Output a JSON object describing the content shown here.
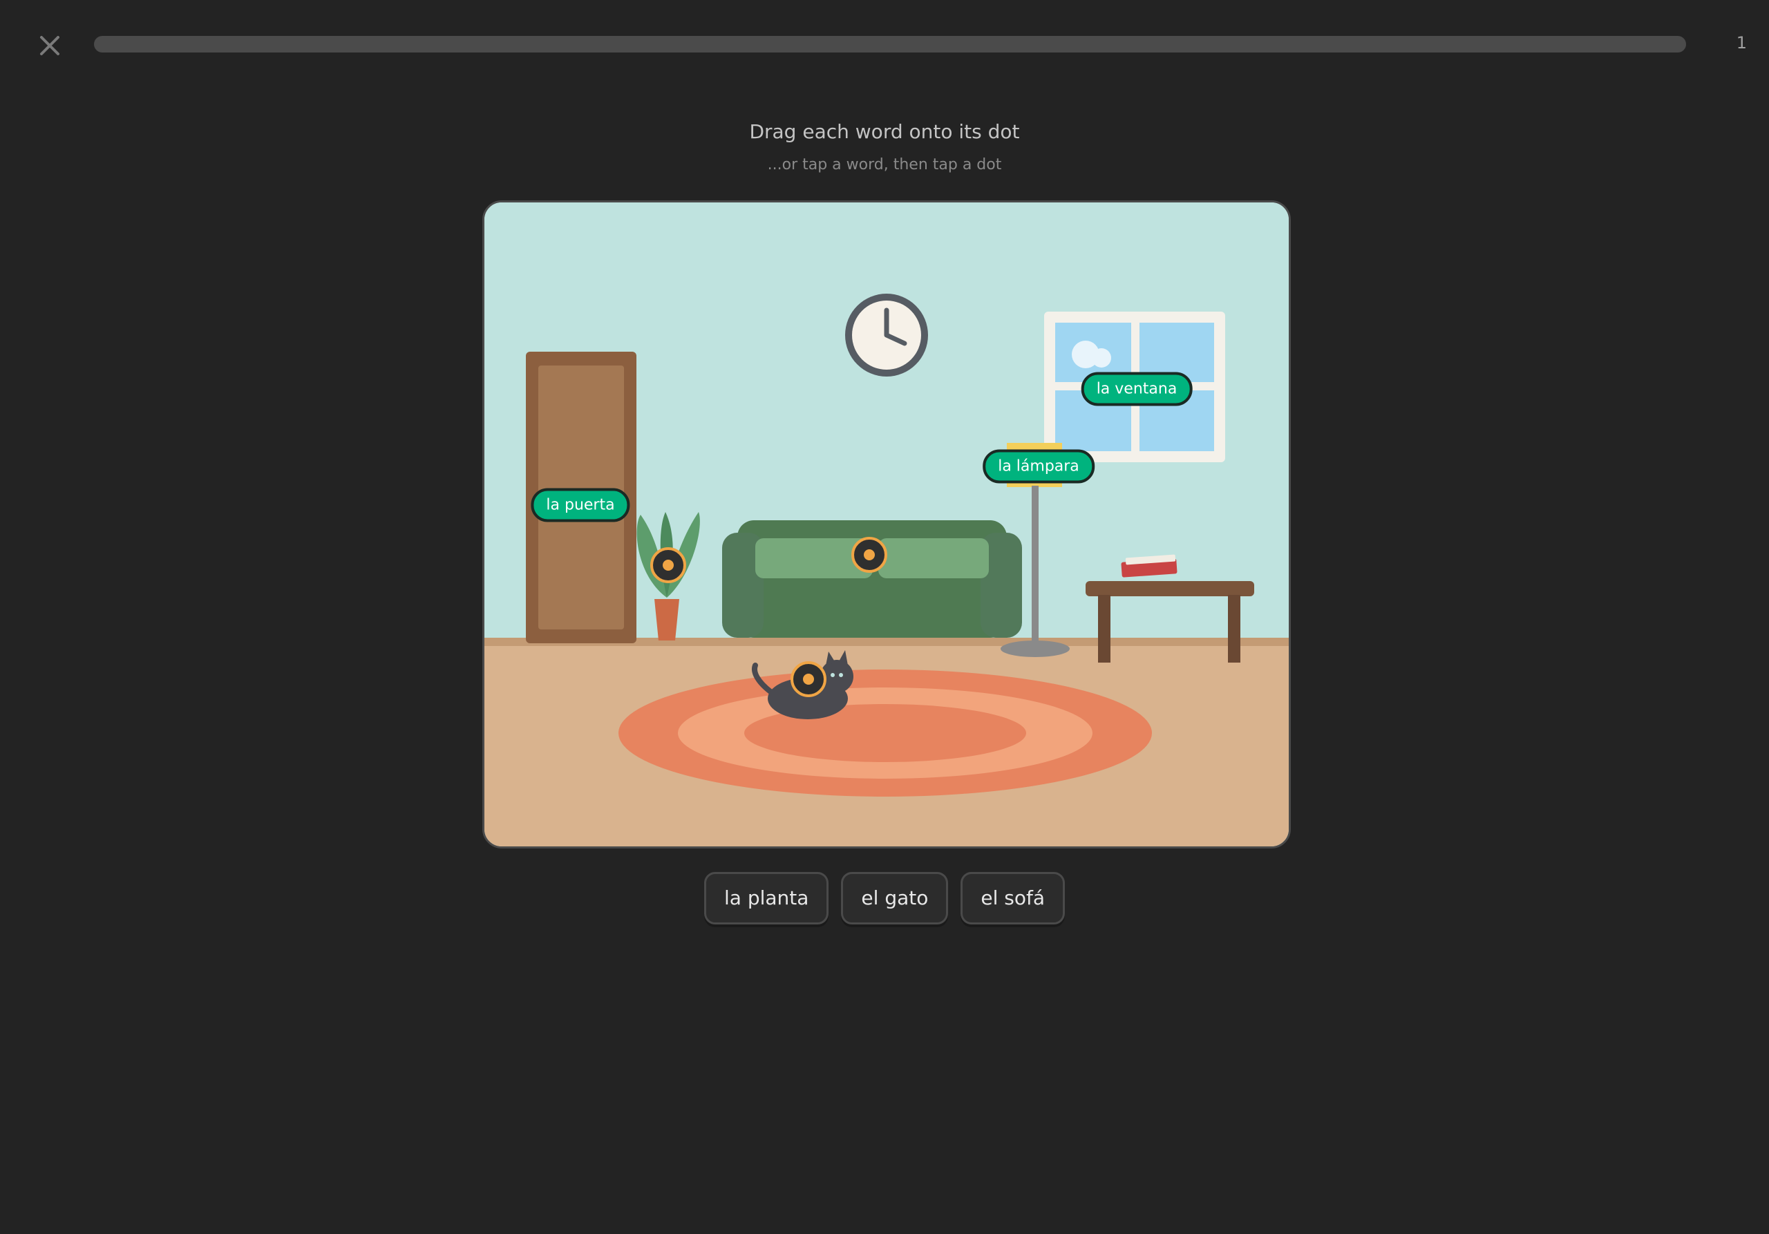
{
  "header": {
    "close_icon": "close-icon",
    "progress_fraction": 0,
    "progress_color": "#58cc02",
    "counter": "1"
  },
  "instructions": {
    "title": "Drag each word onto its dot",
    "subtitle": "...or tap a word, then tap a dot"
  },
  "scene": {
    "placed_labels": {
      "door": "la puerta",
      "lamp": "la lámpara",
      "window": "la ventana"
    },
    "empty_dots": [
      "plant-dot",
      "sofa-dot",
      "cat-dot"
    ],
    "accent": "#f0a545",
    "correct_color": "#00b37e"
  },
  "word_bank": [
    "la planta",
    "el gato",
    "el sofá"
  ]
}
